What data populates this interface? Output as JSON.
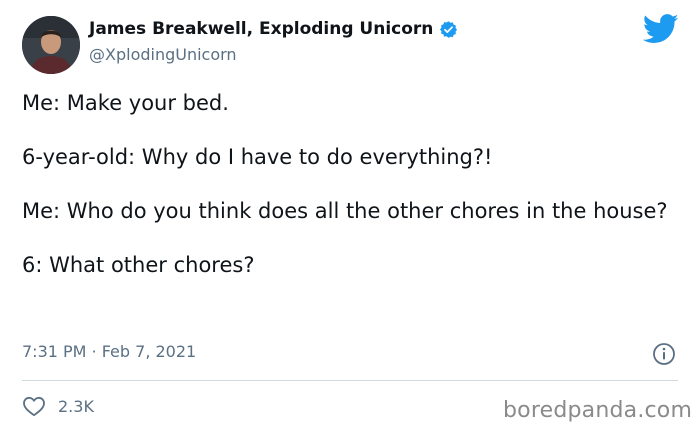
{
  "author": {
    "name": "James Breakwell, Exploding Unicorn",
    "handle": "@XplodingUnicorn",
    "verified": true
  },
  "tweet": {
    "lines": [
      "Me: Make your bed.",
      "6-year-old: Why do I have to do everything?!",
      "Me: Who do you think does all the other chores in the house?",
      "6: What other chores?"
    ],
    "timestamp": "7:31 PM · Feb 7, 2021",
    "likes": "2.3K"
  },
  "watermark": "boredpanda.com",
  "icons": {
    "verified": "verified-badge-icon",
    "brand": "twitter-bird-icon",
    "info": "info-icon",
    "like": "heart-icon"
  },
  "colors": {
    "brand_blue": "#1d9bf0",
    "text_primary": "#0f1419",
    "text_secondary": "#5b7083",
    "divider": "#cfd9de"
  }
}
